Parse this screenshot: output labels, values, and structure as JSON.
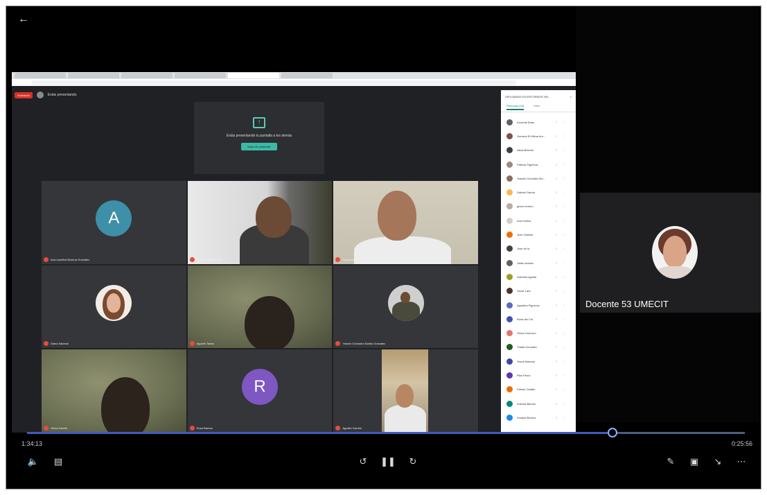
{
  "player": {
    "time_elapsed": "1:34:13",
    "time_remaining": "0:25:56",
    "progress": 0.81,
    "pinned_participant": "Docente 53 UMECIT"
  },
  "icons": {
    "back": "back-arrow-icon",
    "volume": "volume-icon",
    "captions": "captions-icon",
    "rewind": "rewind-10-icon",
    "pause": "pause-icon",
    "forward": "forward-30-icon",
    "pen": "pen-icon",
    "screen": "cast-screen-icon",
    "collapse": "collapse-icon",
    "more": "more-icon"
  },
  "meet": {
    "recording_label": "Grabando",
    "presenting_label": "Estás presentando",
    "present_message": "Estás presentando tu pantalla a los demás",
    "stop_button": "Dejar de presentar",
    "panel_title": "DIPLOMADO EN ENTORNOS VIR...",
    "tab_people": "Personas (26)",
    "tab_chat": "Chat"
  },
  "tiles": [
    {
      "name": "Ana Josefina Becerra Gonzalez",
      "avatar": "A",
      "color": "#3e8fa8"
    },
    {
      "name": "Docente participante",
      "avatar": "",
      "color": ""
    },
    {
      "name": "Participante",
      "avatar": "",
      "color": ""
    },
    {
      "name": "Diana Salcedo",
      "avatar": "",
      "color": ""
    },
    {
      "name": "Agustin Tadeo",
      "avatar": "",
      "color": ""
    },
    {
      "name": "Yasmin Gonzalez Murillo Gonzalez",
      "avatar": "",
      "color": ""
    },
    {
      "name": "Gloria Gareth",
      "avatar": "",
      "color": ""
    },
    {
      "name": "Rosa Barrios",
      "avatar": "R",
      "color": "#7e57c2"
    },
    {
      "name": "Agustin Garrido",
      "avatar": "",
      "color": ""
    }
  ],
  "participants": [
    {
      "name": "Docente Arias",
      "color": "#5f6368"
    },
    {
      "name": "Gerardo El-Hilma Am...",
      "color": "#795548"
    },
    {
      "name": "Alicia Briceño",
      "color": "#3c4043"
    },
    {
      "name": "Patricia Figueroa",
      "color": "#a1887f"
    },
    {
      "name": "Yasmin Gonzalez Mu...",
      "color": "#8d6e63"
    },
    {
      "name": "Gabriel Garcia",
      "color": "#ffb74d"
    },
    {
      "name": "gloria romero",
      "color": "#bcaaa4"
    },
    {
      "name": "Ana molina",
      "color": "#d7ccc8"
    },
    {
      "name": "Jose Galindo",
      "color": "#ef6c00"
    },
    {
      "name": "Jose de la",
      "color": "#424242"
    },
    {
      "name": "Julian Acosta",
      "color": "#616161"
    },
    {
      "name": "Gabriela aguilar",
      "color": "#9e9d24"
    },
    {
      "name": "Oscar Lara",
      "color": "#4e342e"
    },
    {
      "name": "Agustina Figueroa",
      "color": "#5c6bc0"
    },
    {
      "name": "Rosa del Cid",
      "color": "#3f51b5"
    },
    {
      "name": "Gloria Guerrero",
      "color": "#e57373"
    },
    {
      "name": "Thalia Gonzalez",
      "color": "#1b5e20"
    },
    {
      "name": "Yesell Salcedo",
      "color": "#3949ab"
    },
    {
      "name": "Pilar Perez",
      "color": "#5e35b1"
    },
    {
      "name": "Fabian Castillo",
      "color": "#ef6c00"
    },
    {
      "name": "Zulema Barrios",
      "color": "#00897b"
    },
    {
      "name": "Zoraida Barrios",
      "color": "#1e88e5"
    }
  ]
}
